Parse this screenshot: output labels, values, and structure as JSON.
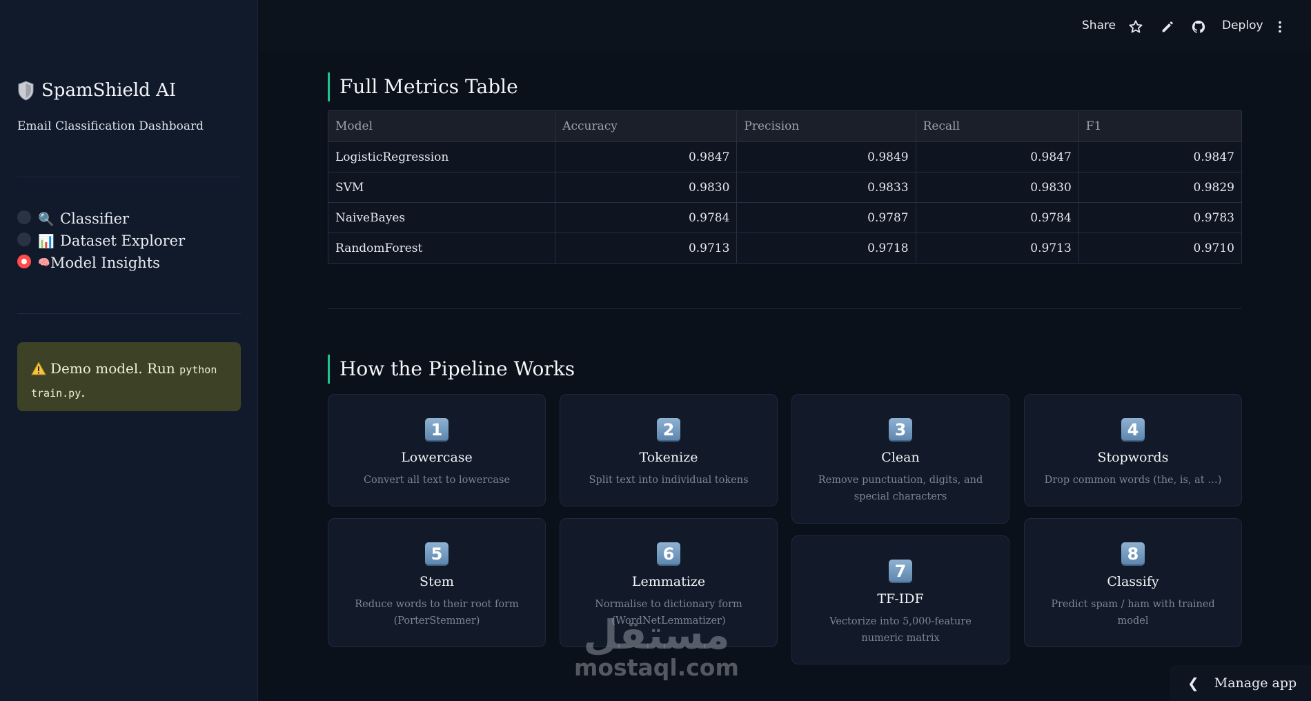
{
  "sidebar": {
    "app_title": "SpamShield AI",
    "subtitle": "Email Classification Dashboard",
    "nav": [
      {
        "emoji": "🔍",
        "label": "Classifier",
        "selected": false
      },
      {
        "emoji": "📊",
        "label": "Dataset Explorer",
        "selected": false
      },
      {
        "emoji": "🧠",
        "label": "Model Insights",
        "selected": true
      }
    ],
    "warning_text": "Demo model. Run ",
    "warning_code": "python train.py",
    "warning_end": "."
  },
  "topbar": {
    "share": "Share",
    "deploy": "Deploy"
  },
  "metrics": {
    "title": "Full Metrics Table",
    "columns": [
      "Model",
      "Accuracy",
      "Precision",
      "Recall",
      "F1"
    ],
    "rows": [
      [
        "LogisticRegression",
        "0.9847",
        "0.9849",
        "0.9847",
        "0.9847"
      ],
      [
        "SVM",
        "0.9830",
        "0.9833",
        "0.9830",
        "0.9829"
      ],
      [
        "NaiveBayes",
        "0.9784",
        "0.9787",
        "0.9784",
        "0.9783"
      ],
      [
        "RandomForest",
        "0.9713",
        "0.9718",
        "0.9713",
        "0.9710"
      ]
    ]
  },
  "pipeline": {
    "title": "How the Pipeline Works",
    "steps": [
      {
        "n": "1",
        "title": "Lowercase",
        "desc": "Convert all text to lowercase"
      },
      {
        "n": "2",
        "title": "Tokenize",
        "desc": "Split text into individual tokens"
      },
      {
        "n": "3",
        "title": "Clean",
        "desc": "Remove punctuation, digits, and special characters"
      },
      {
        "n": "4",
        "title": "Stopwords",
        "desc": "Drop common words (the, is, at …)"
      },
      {
        "n": "5",
        "title": "Stem",
        "desc": "Reduce words to their root form (PorterStemmer)"
      },
      {
        "n": "6",
        "title": "Lemmatize",
        "desc": "Normalise to dictionary form (WordNetLemmatizer)"
      },
      {
        "n": "7",
        "title": "TF-IDF",
        "desc": "Vectorize into 5,000-feature numeric matrix"
      },
      {
        "n": "8",
        "title": "Classify",
        "desc": "Predict spam / ham with trained model"
      }
    ]
  },
  "manage_app": "Manage app",
  "watermark": {
    "arabic": "مستقل",
    "latin": "mostaql.com"
  },
  "colors": {
    "accent": "#22c58b",
    "radio_on": "#ff4b4b",
    "warning_bg": "#3d4226"
  }
}
